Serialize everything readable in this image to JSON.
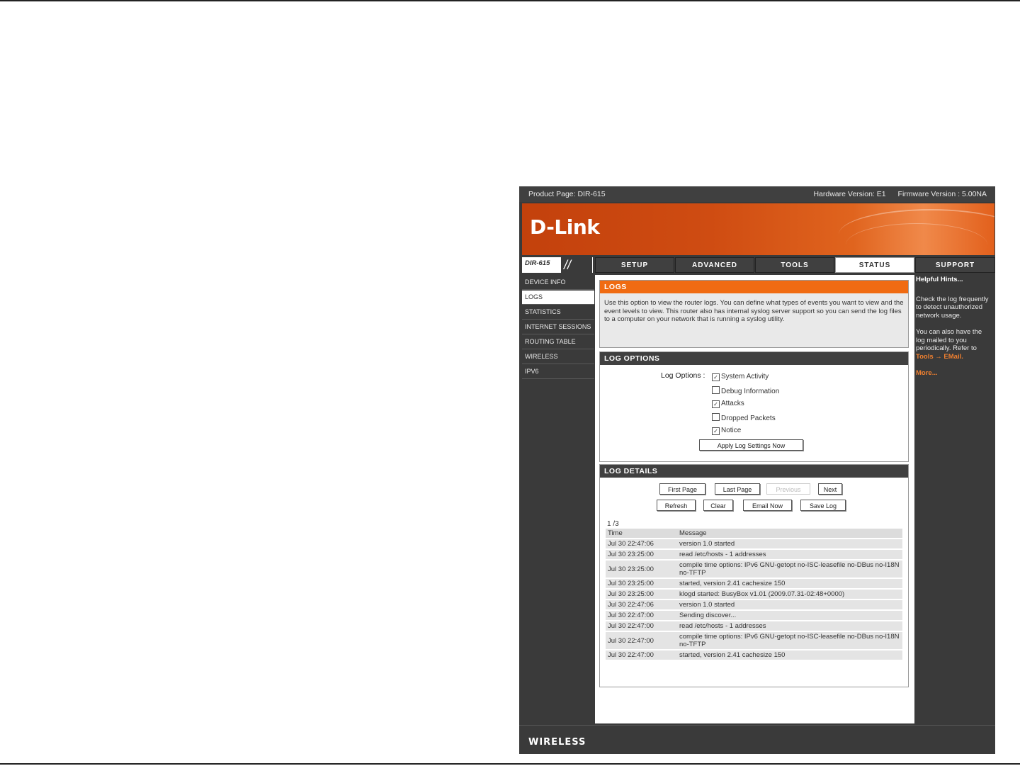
{
  "topbar": {
    "product": "Product Page: DIR-615",
    "hardware": "Hardware Version: E1",
    "firmware": "Firmware Version : 5.00NA"
  },
  "logo": "D-Link",
  "model": "DIR-615",
  "tabs": [
    {
      "label": "SETUP"
    },
    {
      "label": "ADVANCED"
    },
    {
      "label": "TOOLS"
    },
    {
      "label": "STATUS"
    },
    {
      "label": "SUPPORT"
    }
  ],
  "leftnav": [
    "DEVICE INFO",
    "LOGS",
    "STATISTICS",
    "INTERNET SESSIONS",
    "ROUTING TABLE",
    "WIRELESS",
    "IPV6"
  ],
  "logs_panel": {
    "title": "LOGS",
    "desc": "Use this option to view the router logs. You can define what types of events you want to view and the event levels to view. This router also has internal syslog server support so you can send the log files to a computer on your network that is running a syslog utility."
  },
  "log_options": {
    "title": "LOG OPTIONS",
    "label": "Log Options :",
    "options": [
      {
        "label": "System Activity",
        "checked": true
      },
      {
        "label": "Debug Information",
        "checked": false
      },
      {
        "label": "Attacks",
        "checked": true
      },
      {
        "label": "Dropped Packets",
        "checked": false
      },
      {
        "label": "Notice",
        "checked": true
      }
    ],
    "apply_button": "Apply Log Settings Now"
  },
  "log_details": {
    "title": "LOG DETAILS",
    "buttons_row1": [
      "First Page",
      "Last Page",
      "Previous",
      "Next"
    ],
    "buttons_row2": [
      "Refresh",
      "Clear",
      "Email Now",
      "Save Log"
    ],
    "page": "1 /3",
    "columns": [
      "Time",
      "Message"
    ],
    "rows": [
      [
        "Jul 30 22:47:06",
        "version 1.0 started"
      ],
      [
        "Jul 30 23:25:00",
        "read /etc/hosts - 1 addresses"
      ],
      [
        "Jul 30 23:25:00",
        "compile time options: IPv6 GNU-getopt no-ISC-leasefile no-DBus no-I18N no-TFTP"
      ],
      [
        "Jul 30 23:25:00",
        "started, version 2.41 cachesize 150"
      ],
      [
        "Jul 30 23:25:00",
        "klogd started: BusyBox v1.01 (2009.07.31-02:48+0000)"
      ],
      [
        "Jul 30 22:47:06",
        "version 1.0 started"
      ],
      [
        "Jul 30 22:47:00",
        "Sending discover..."
      ],
      [
        "Jul 30 22:47:00",
        "read /etc/hosts - 1 addresses"
      ],
      [
        "Jul 30 22:47:00",
        "compile time options: IPv6 GNU-getopt no-ISC-leasefile no-DBus no-I18N no-TFTP"
      ],
      [
        "Jul 30 22:47:00",
        "started, version 2.41 cachesize 150"
      ]
    ]
  },
  "hints": {
    "title": "Helpful Hints...",
    "p1": "Check the log frequently to detect unauthorized network usage.",
    "p2": "You can also have the log mailed to you periodically. Refer to",
    "p2_link": "Tools → EMail.",
    "more": "More..."
  },
  "footer": "WIRELESS"
}
